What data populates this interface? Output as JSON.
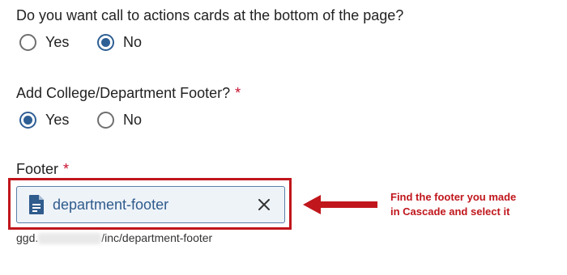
{
  "questions": {
    "cta": {
      "text": "Do you want call to actions cards at the bottom of the page?",
      "options": [
        {
          "label": "Yes",
          "selected": false
        },
        {
          "label": "No",
          "selected": true
        }
      ]
    },
    "footer_toggle": {
      "text": "Add College/Department Footer?",
      "required_mark": "*",
      "options": [
        {
          "label": "Yes",
          "selected": true
        },
        {
          "label": "No",
          "selected": false
        }
      ]
    },
    "footer": {
      "text": "Footer",
      "required_mark": "*"
    }
  },
  "picker": {
    "icon": "document-icon",
    "value": "department-footer",
    "clear_icon": "close-icon",
    "path_prefix": "ggd.",
    "path_suffix": "/inc/department-footer"
  },
  "annotation": {
    "line1": "Find the footer you made",
    "line2": "in Cascade and select it",
    "color": "#c0161c"
  },
  "colors": {
    "radio_selected": "#2e5f94",
    "link_text": "#2f5b8d",
    "required": "#c8102e"
  }
}
